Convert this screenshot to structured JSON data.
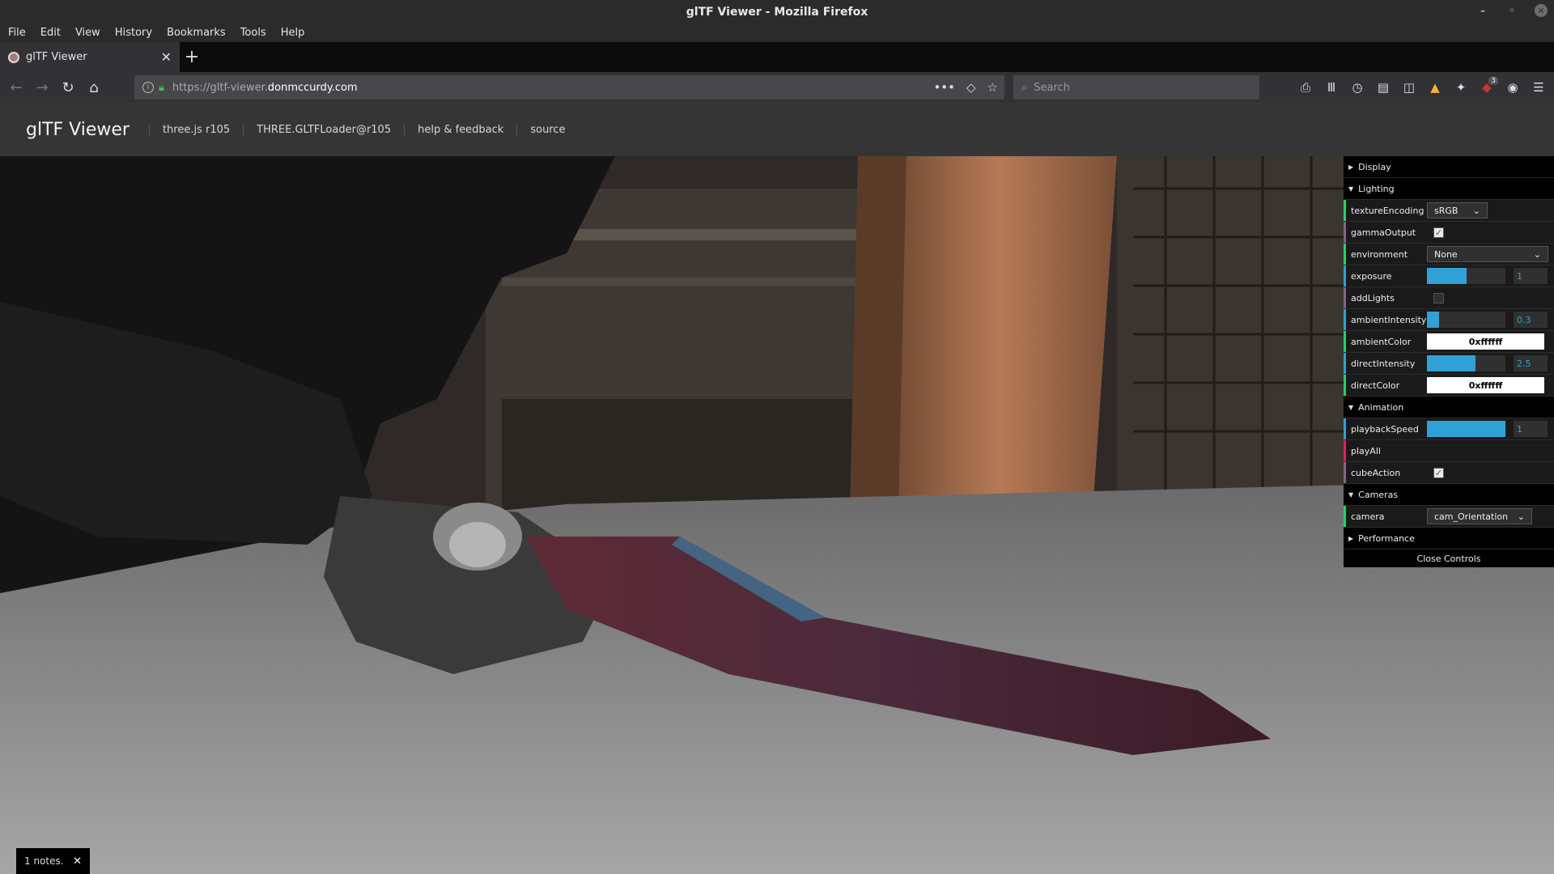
{
  "window": {
    "title": "glTF Viewer - Mozilla Firefox",
    "controls": [
      "minimize-icon",
      "maximize-icon",
      "close-icon"
    ]
  },
  "menubar": {
    "items": [
      "File",
      "Edit",
      "View",
      "History",
      "Bookmarks",
      "Tools",
      "Help"
    ]
  },
  "tabs": [
    {
      "label": "glTF Viewer",
      "icon": "favicon"
    }
  ],
  "navbar": {
    "url_prefix": "https://gltf-viewer.",
    "url_host": "donmccurdy.com",
    "search_placeholder": "Search",
    "addon_badge": "3"
  },
  "header": {
    "title": "glTF Viewer",
    "links": [
      "three.js r105",
      "THREE.GLTFLoader@r105",
      "help & feedback",
      "source"
    ]
  },
  "gui": {
    "folders": {
      "display": "Display",
      "lighting": "Lighting",
      "animation": "Animation",
      "cameras": "Cameras",
      "performance": "Performance"
    },
    "lighting": {
      "textureEncoding": {
        "label": "textureEncoding",
        "value": "sRGB"
      },
      "gammaOutput": {
        "label": "gammaOutput",
        "checked": true
      },
      "environment": {
        "label": "environment",
        "value": "None"
      },
      "exposure": {
        "label": "exposure",
        "value": "1",
        "fraction": 0.5
      },
      "addLights": {
        "label": "addLights",
        "checked": false
      },
      "ambientIntensity": {
        "label": "ambientIntensity",
        "value": "0.3",
        "fraction": 0.15
      },
      "ambientColor": {
        "label": "ambientColor",
        "value": "0xffffff"
      },
      "directIntensity": {
        "label": "directIntensity",
        "value": "2.5",
        "fraction": 0.62
      },
      "directColor": {
        "label": "directColor",
        "value": "0xffffff"
      }
    },
    "animation": {
      "playbackSpeed": {
        "label": "playbackSpeed",
        "value": "1",
        "fraction": 1.0
      },
      "playAll": {
        "label": "playAll"
      },
      "cubeAction": {
        "label": "cubeAction",
        "checked": true
      }
    },
    "cameras": {
      "camera": {
        "label": "camera",
        "value": "cam_Orientation"
      }
    },
    "close_label": "Close Controls"
  },
  "toast": {
    "text": "1 notes."
  },
  "colors": {
    "number_accent": "#2fa1d6",
    "boolean_accent": "#806787",
    "string_accent": "#1ed36f",
    "secure_lock": "#3ac25b"
  }
}
